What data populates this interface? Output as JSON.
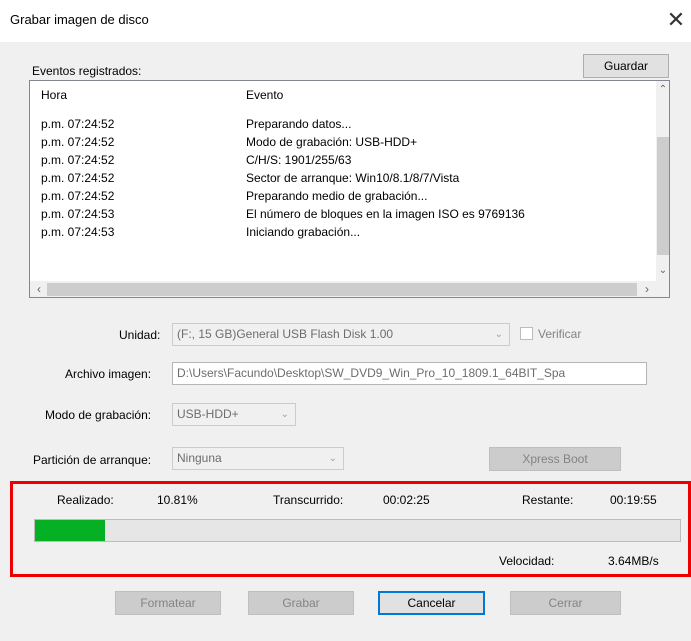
{
  "window": {
    "title": "Grabar imagen de disco",
    "close_glyph": "✕"
  },
  "log": {
    "label": "Eventos registrados:",
    "save_button": "Guardar",
    "columns": [
      "Hora",
      "Evento"
    ],
    "rows": [
      [
        "p.m. 07:24:52",
        "Preparando datos..."
      ],
      [
        "p.m. 07:24:52",
        "Modo de grabación: USB-HDD+"
      ],
      [
        "p.m. 07:24:52",
        "C/H/S: 1901/255/63"
      ],
      [
        "p.m. 07:24:52",
        "Sector de arranque: Win10/8.1/8/7/Vista"
      ],
      [
        "p.m. 07:24:52",
        "Preparando medio de grabación..."
      ],
      [
        "p.m. 07:24:53",
        "El número de bloques en la imagen ISO es 9769136"
      ],
      [
        "p.m. 07:24:53",
        "Iniciando grabación..."
      ]
    ]
  },
  "form": {
    "unit_label": "Unidad:",
    "unit_value": "(F:, 15 GB)General USB Flash Disk  1.00",
    "verify_label": "Verificar",
    "verify_checked": false,
    "image_label": "Archivo imagen:",
    "image_value": "D:\\Users\\Facundo\\Desktop\\SW_DVD9_Win_Pro_10_1809.1_64BIT_Spa",
    "mode_label": "Modo de grabación:",
    "mode_value": "USB-HDD+",
    "partition_label": "Partición de arranque:",
    "partition_value": "Ninguna",
    "xpress_button": "Xpress Boot"
  },
  "progress": {
    "done_label": "Realizado:",
    "done_value": "10.81%",
    "done_fraction": 0.1081,
    "elapsed_label": "Transcurrido:",
    "elapsed_value": "00:02:25",
    "remaining_label": "Restante:",
    "remaining_value": "00:19:55",
    "speed_label": "Velocidad:",
    "speed_value": "3.64MB/s",
    "fill_color": "#06b025",
    "highlight_color": "#ee0000"
  },
  "buttons": {
    "format": "Formatear",
    "burn": "Grabar",
    "cancel": "Cancelar",
    "close": "Cerrar"
  }
}
